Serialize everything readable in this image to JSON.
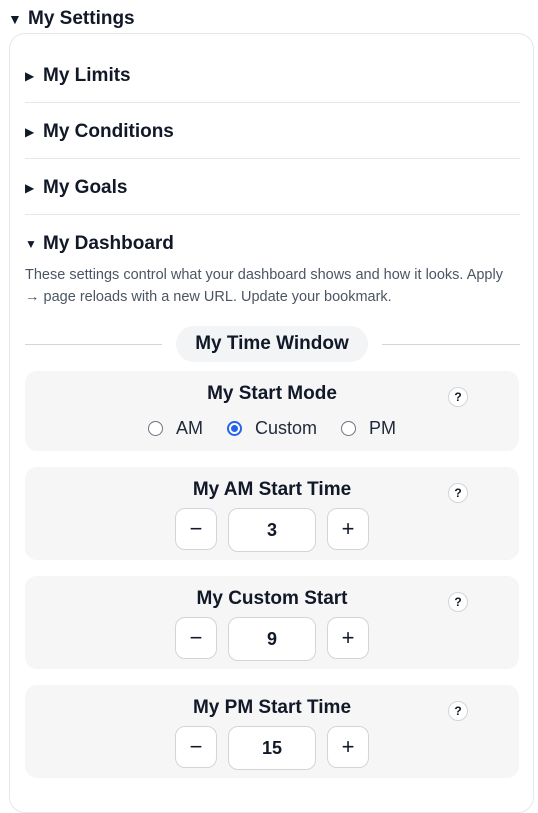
{
  "settings": {
    "title": "My Settings",
    "expanded_icon": "triangle-down-icon"
  },
  "sections": {
    "limits": {
      "label": "My Limits"
    },
    "conditions": {
      "label": "My Conditions"
    },
    "goals": {
      "label": "My Goals"
    },
    "dashboard": {
      "label": "My Dashboard",
      "description": "These settings control what your dashboard shows and how it looks. Apply → page reloads with a new URL. Update your bookmark."
    }
  },
  "time_window": {
    "title": "My Time Window",
    "start_mode": {
      "title": "My Start Mode",
      "help": "?",
      "options": [
        "AM",
        "Custom",
        "PM"
      ],
      "selected": "Custom"
    },
    "am_start": {
      "title": "My AM Start Time",
      "help": "?",
      "value": "3",
      "minus": "−",
      "plus": "+"
    },
    "custom_start": {
      "title": "My Custom Start",
      "help": "?",
      "value": "9",
      "minus": "−",
      "plus": "+"
    },
    "pm_start": {
      "title": "My PM Start Time",
      "help": "?",
      "value": "15",
      "minus": "−",
      "plus": "+"
    }
  },
  "colors": {
    "accent": "#2563eb",
    "panel": "#f6f6f7",
    "border": "#e5e7eb"
  }
}
